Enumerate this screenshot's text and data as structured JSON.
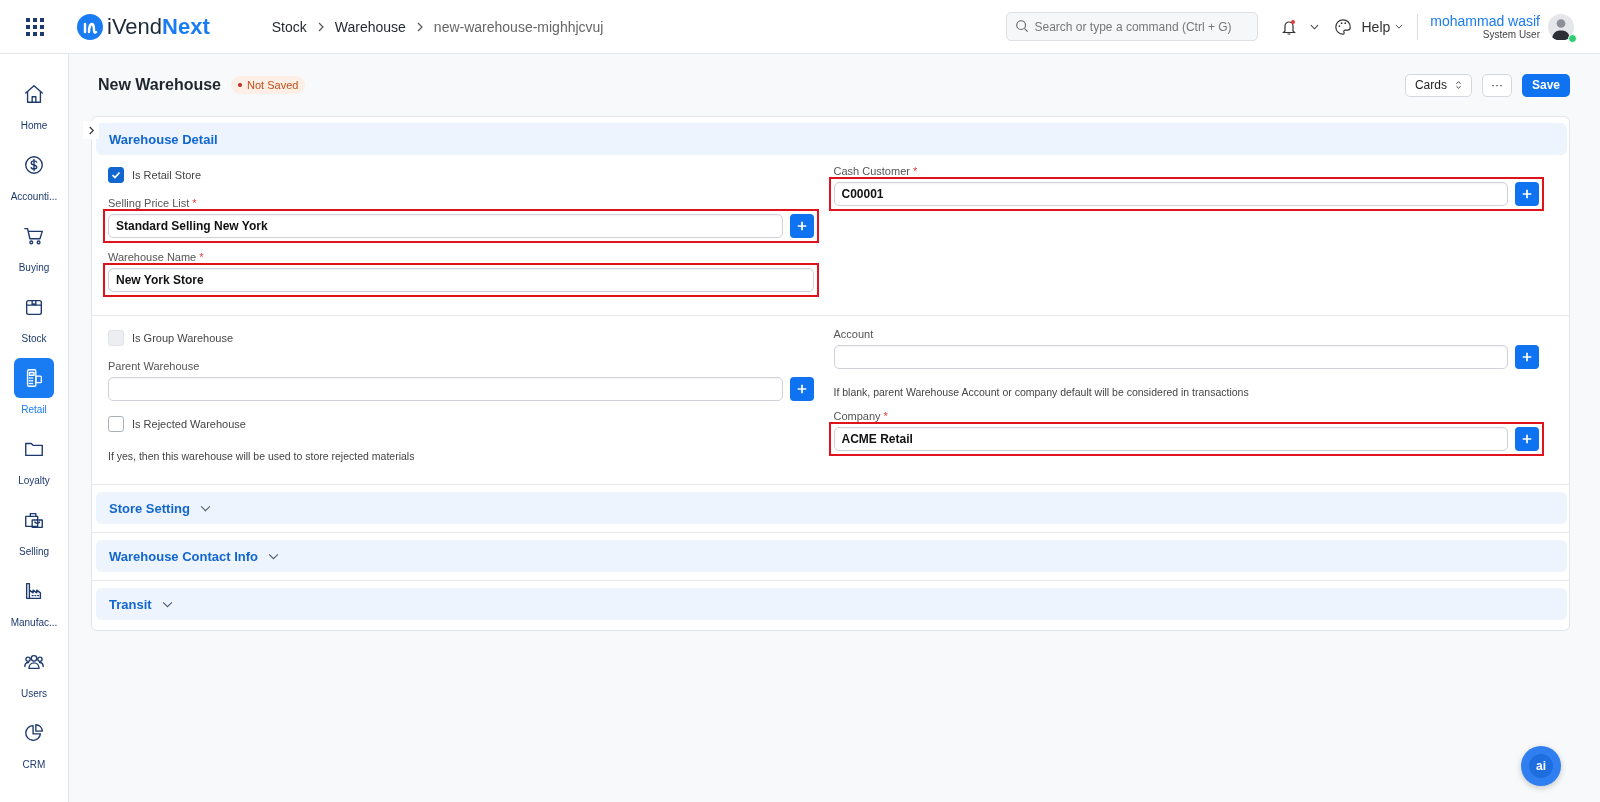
{
  "navbar": {
    "brand": {
      "first": "iVend",
      "second": "Next"
    },
    "breadcrumbs": [
      "Stock",
      "Warehouse",
      "new-warehouse-mighhjcvuj"
    ],
    "search": {
      "placeholder": "Search or type a command (Ctrl + G)"
    },
    "notifications": {
      "unread": true
    },
    "help": "Help",
    "user": {
      "name": "mohammad wasif",
      "role": "System User",
      "online": true
    }
  },
  "sidebar": {
    "items": [
      {
        "kind": "home",
        "label": "Home",
        "selected": false
      },
      {
        "kind": "accounting",
        "label": "Accounti...",
        "selected": false
      },
      {
        "kind": "buying",
        "label": "Buying",
        "selected": false
      },
      {
        "kind": "stock",
        "label": "Stock",
        "selected": false
      },
      {
        "kind": "retail",
        "label": "Retail",
        "selected": true
      },
      {
        "kind": "loyalty",
        "label": "Loyalty",
        "selected": false
      },
      {
        "kind": "selling",
        "label": "Selling",
        "selected": false
      },
      {
        "kind": "manufacturing",
        "label": "Manufac...",
        "selected": false
      },
      {
        "kind": "users",
        "label": "Users",
        "selected": false
      },
      {
        "kind": "crm",
        "label": "CRM",
        "selected": false
      }
    ]
  },
  "page": {
    "title": "New Warehouse",
    "status": "Not Saved",
    "view_button": "Cards",
    "more_button": "···",
    "save_button": "Save"
  },
  "sections": [
    {
      "title": "Warehouse Detail",
      "expanded": true,
      "groups": [
        {
          "left": [
            {
              "kind": "checkbox",
              "label": "Is Retail Store",
              "checked": true,
              "disabled": false
            },
            {
              "kind": "link",
              "label": "Selling Price List",
              "required_mark": "*",
              "value": "Standard Selling New York",
              "highlighted": true
            },
            {
              "kind": "data",
              "label": "Warehouse Name",
              "required_mark": "*",
              "value": "New York Store",
              "highlighted": true
            }
          ],
          "right": [
            {
              "kind": "link",
              "label": "Cash Customer",
              "required_mark": "*",
              "value": "C00001",
              "highlighted": true
            }
          ]
        },
        {
          "left": [
            {
              "kind": "checkbox",
              "label": "Is Group Warehouse",
              "checked": false,
              "disabled": true
            },
            {
              "kind": "link",
              "label": "Parent Warehouse",
              "highlighted": false
            },
            {
              "kind": "checkbox",
              "label": "Is Rejected Warehouse",
              "checked": false,
              "disabled": false,
              "description": "If yes, then this warehouse will be used to store rejected materials"
            }
          ],
          "right": [
            {
              "kind": "link",
              "label": "Account",
              "highlighted": false,
              "description": "If blank, parent Warehouse Account or company default will be considered in transactions"
            },
            {
              "kind": "link",
              "label": "Company",
              "required_mark": "*",
              "value": "ACME Retail",
              "highlighted": true
            }
          ]
        }
      ]
    },
    {
      "title": "Store Setting",
      "expanded": false
    },
    {
      "title": "Warehouse Contact Info",
      "expanded": false
    },
    {
      "title": "Transit",
      "expanded": false
    }
  ],
  "assistant_button": "ai"
}
